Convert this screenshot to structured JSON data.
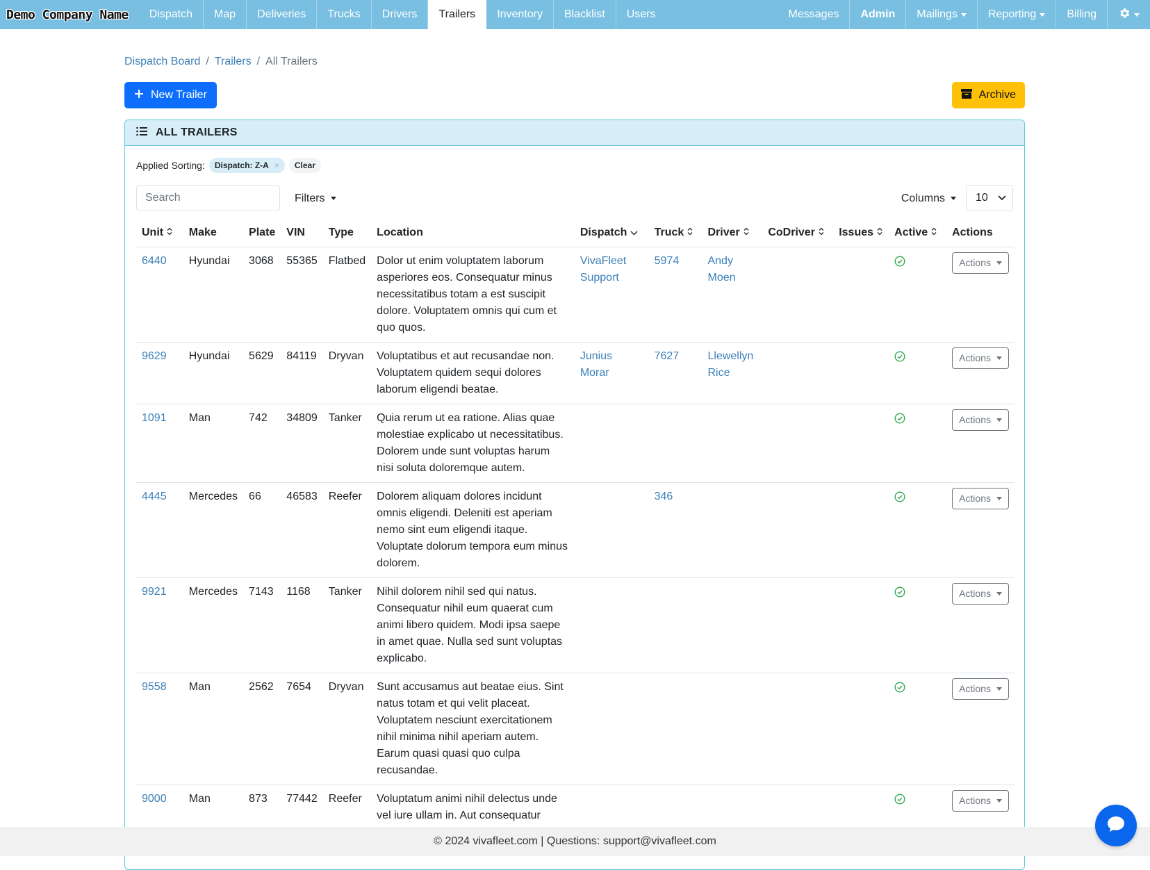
{
  "nav": {
    "brand": "Demo Company Name",
    "left": [
      "Dispatch",
      "Map",
      "Deliveries",
      "Trucks",
      "Drivers",
      "Trailers",
      "Inventory",
      "Blacklist",
      "Users"
    ],
    "right": [
      "Messages",
      "Admin",
      "Mailings",
      "Reporting",
      "Billing"
    ],
    "active": "Trailers"
  },
  "breadcrumb": {
    "item1": "Dispatch Board",
    "item2": "Trailers",
    "current": "All Trailers",
    "sep": "/"
  },
  "buttons": {
    "new_trailer": "New Trailer",
    "archive": "Archive"
  },
  "card": {
    "title": "ALL TRAILERS"
  },
  "sorting": {
    "label": "Applied Sorting:",
    "chip": "Dispatch: Z-A",
    "clear": "Clear"
  },
  "controls": {
    "search_placeholder": "Search",
    "filters": "Filters",
    "columns": "Columns",
    "per_page": "10"
  },
  "table": {
    "headers": [
      "Unit",
      "Make",
      "Plate",
      "VIN",
      "Type",
      "Location",
      "Dispatch",
      "Truck",
      "Driver",
      "CoDriver",
      "Issues",
      "Active",
      "Actions"
    ],
    "action_label": "Actions",
    "rows": [
      {
        "unit": "6440",
        "make": "Hyundai",
        "plate": "3068",
        "vin": "55365",
        "type": "Flatbed",
        "location": "Dolor ut enim voluptatem laborum asperiores eos. Consequatur minus necessitatibus totam a est suscipit dolore. Voluptatem omnis qui cum et quo quos.",
        "dispatch": "VivaFleet Support",
        "truck": "5974",
        "driver": "Andy Moen",
        "codriver": "",
        "issues": "",
        "active": true
      },
      {
        "unit": "9629",
        "make": "Hyundai",
        "plate": "5629",
        "vin": "84119",
        "type": "Dryvan",
        "location": "Voluptatibus et aut recusandae non. Voluptatem quidem sequi dolores laborum eligendi beatae.",
        "dispatch": "Junius Morar",
        "truck": "7627",
        "driver": "Llewellyn Rice",
        "codriver": "",
        "issues": "",
        "active": true
      },
      {
        "unit": "1091",
        "make": "Man",
        "plate": "742",
        "vin": "34809",
        "type": "Tanker",
        "location": "Quia rerum ut ea ratione. Alias quae molestiae explicabo ut necessitatibus. Dolorem unde sunt voluptas harum nisi soluta doloremque autem.",
        "dispatch": "",
        "truck": "",
        "driver": "",
        "codriver": "",
        "issues": "",
        "active": true
      },
      {
        "unit": "4445",
        "make": "Mercedes",
        "plate": "66",
        "vin": "46583",
        "type": "Reefer",
        "location": "Dolorem aliquam dolores incidunt omnis eligendi. Deleniti est aperiam nemo sint eum eligendi itaque. Voluptate dolorum tempora eum minus dolorem.",
        "dispatch": "",
        "truck": "346",
        "driver": "",
        "codriver": "",
        "issues": "",
        "active": true
      },
      {
        "unit": "9921",
        "make": "Mercedes",
        "plate": "7143",
        "vin": "1168",
        "type": "Tanker",
        "location": "Nihil dolorem nihil sed qui natus. Consequatur nihil eum quaerat cum animi libero quidem. Modi ipsa saepe in amet quae. Nulla sed sunt voluptas explicabo.",
        "dispatch": "",
        "truck": "",
        "driver": "",
        "codriver": "",
        "issues": "",
        "active": true
      },
      {
        "unit": "9558",
        "make": "Man",
        "plate": "2562",
        "vin": "7654",
        "type": "Dryvan",
        "location": "Sunt accusamus aut beatae eius. Sint natus totam et qui velit placeat. Voluptatem nesciunt exercitationem nihil minima nihil aperiam autem. Earum quasi quasi quo culpa recusandae.",
        "dispatch": "",
        "truck": "",
        "driver": "",
        "codriver": "",
        "issues": "",
        "active": true
      },
      {
        "unit": "9000",
        "make": "Man",
        "plate": "873",
        "vin": "77442",
        "type": "Reefer",
        "location": "Voluptatum animi nihil delectus unde vel iure ullam in. Aut consequatur",
        "dispatch": "",
        "truck": "",
        "driver": "",
        "codriver": "",
        "issues": "",
        "active": true
      }
    ]
  },
  "footer": {
    "text": "© 2024 vivafleet.com | Questions: support@vivafleet.com"
  },
  "icons": {
    "settings": "gear-icon",
    "chat": "chat-bubble-icon",
    "list": "list-icon",
    "archive": "archive-box-icon",
    "plus": "plus-icon",
    "active": "check-circle-icon"
  },
  "colors": {
    "navbar": "#78bfe1",
    "primary": "#0d6efd",
    "archive": "#ffc107",
    "link": "#3a7fb8",
    "active": "#28a745",
    "card_border": "#5ec7e3",
    "card_header": "#d7eef8"
  }
}
